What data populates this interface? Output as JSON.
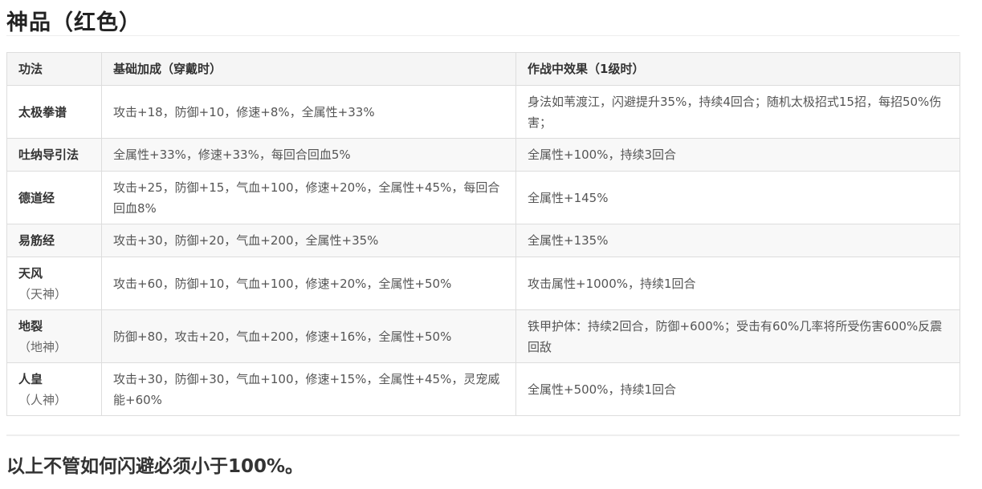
{
  "page": {
    "title": "神品（红色）",
    "footer_note": "以上不管如何闪避必须小于100%。"
  },
  "table": {
    "headers": [
      "功法",
      "基础加成（穿戴时）",
      "作战中效果（1级时）"
    ],
    "rows": [
      {
        "name": "太极拳谱",
        "note": "",
        "base": "攻击+18，防御+10，修速+8%，全属性+33%",
        "effect": "身法如苇渡江，闪避提升35%，持续4回合；随机太极招式15招，每招50%伤害；"
      },
      {
        "name": "吐纳导引法",
        "note": "",
        "base": "全属性+33%，修速+33%，每回合回血5%",
        "effect": "全属性+100%，持续3回合"
      },
      {
        "name": "德道经",
        "note": "",
        "base": "攻击+25，防御+15，气血+100，修速+20%，全属性+45%，每回合回血8%",
        "effect": "全属性+145%"
      },
      {
        "name": "易筋经",
        "note": "",
        "base": "攻击+30，防御+20，气血+200，全属性+35%",
        "effect": "全属性+135%"
      },
      {
        "name": "天风",
        "note": "（天神）",
        "base": "攻击+60，防御+10，气血+100，修速+20%，全属性+50%",
        "effect": "攻击属性+1000%，持续1回合"
      },
      {
        "name": "地裂",
        "note": "（地神）",
        "base": "防御+80，攻击+20，气血+200，修速+16%，全属性+50%",
        "effect": "铁甲护体：持续2回合，防御+600%；受击有60%几率将所受伤害600%反震回敌"
      },
      {
        "name": "人皇",
        "note": "（人神）",
        "base": "攻击+30，防御+30，气血+100，修速+15%，全属性+45%，灵宠威能+60%",
        "effect": "全属性+500%，持续1回合"
      }
    ]
  }
}
